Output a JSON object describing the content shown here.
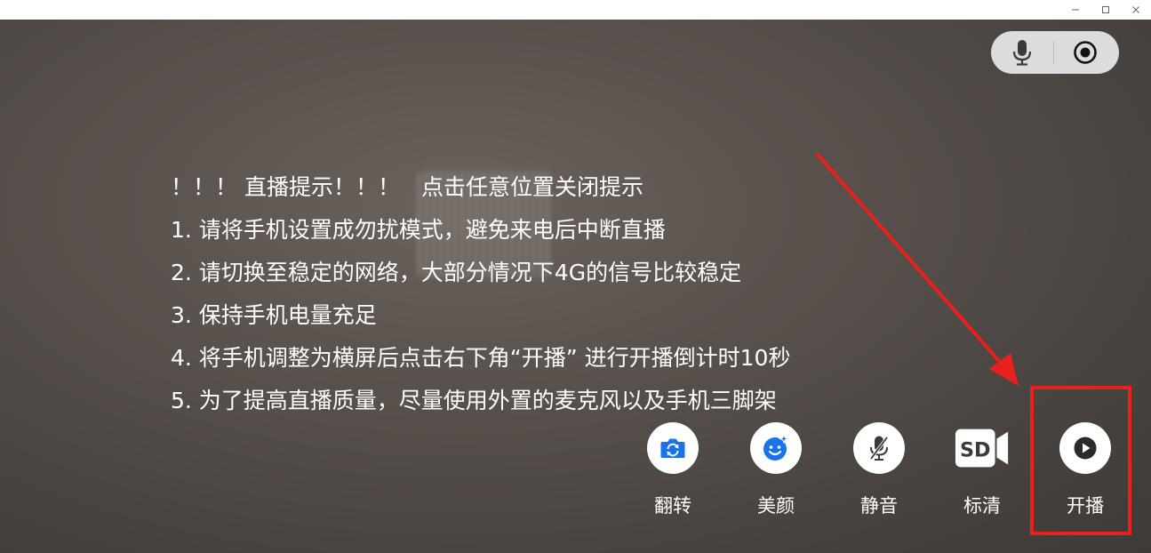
{
  "window": {
    "minimize_icon": "minimize-icon",
    "maximize_icon": "maximize-icon",
    "close_icon": "close-icon"
  },
  "top_controls": {
    "mic_icon": "microphone-icon",
    "record_icon": "record-icon"
  },
  "tips": {
    "header": "！！！ 直播提示！！！",
    "dismiss": "点击任意位置关闭提示",
    "items": [
      "1. 请将手机设置成勿扰模式，避免来电后中断直播",
      "2. 请切换至稳定的网络，大部分情况下4G的信号比较稳定",
      "3. 保持手机电量充足",
      "4. 将手机调整为横屏后点击右下角“开播” 进行开播倒计时10秒",
      "5. 为了提高直播质量，尽量使用外置的麦克风以及手机三脚架"
    ]
  },
  "controls": {
    "flip": {
      "label": "翻转",
      "icon": "camera-flip-icon"
    },
    "beauty": {
      "label": "美颜",
      "icon": "beauty-face-icon"
    },
    "mute": {
      "label": "静音",
      "icon": "mic-off-icon"
    },
    "quality": {
      "label": "标清",
      "badge": "SD",
      "icon": "sd-camera-icon"
    },
    "start": {
      "label": "开播",
      "icon": "play-icon"
    }
  },
  "colors": {
    "accent_blue": "#1a73e8",
    "highlight_red": "#e8201e"
  }
}
